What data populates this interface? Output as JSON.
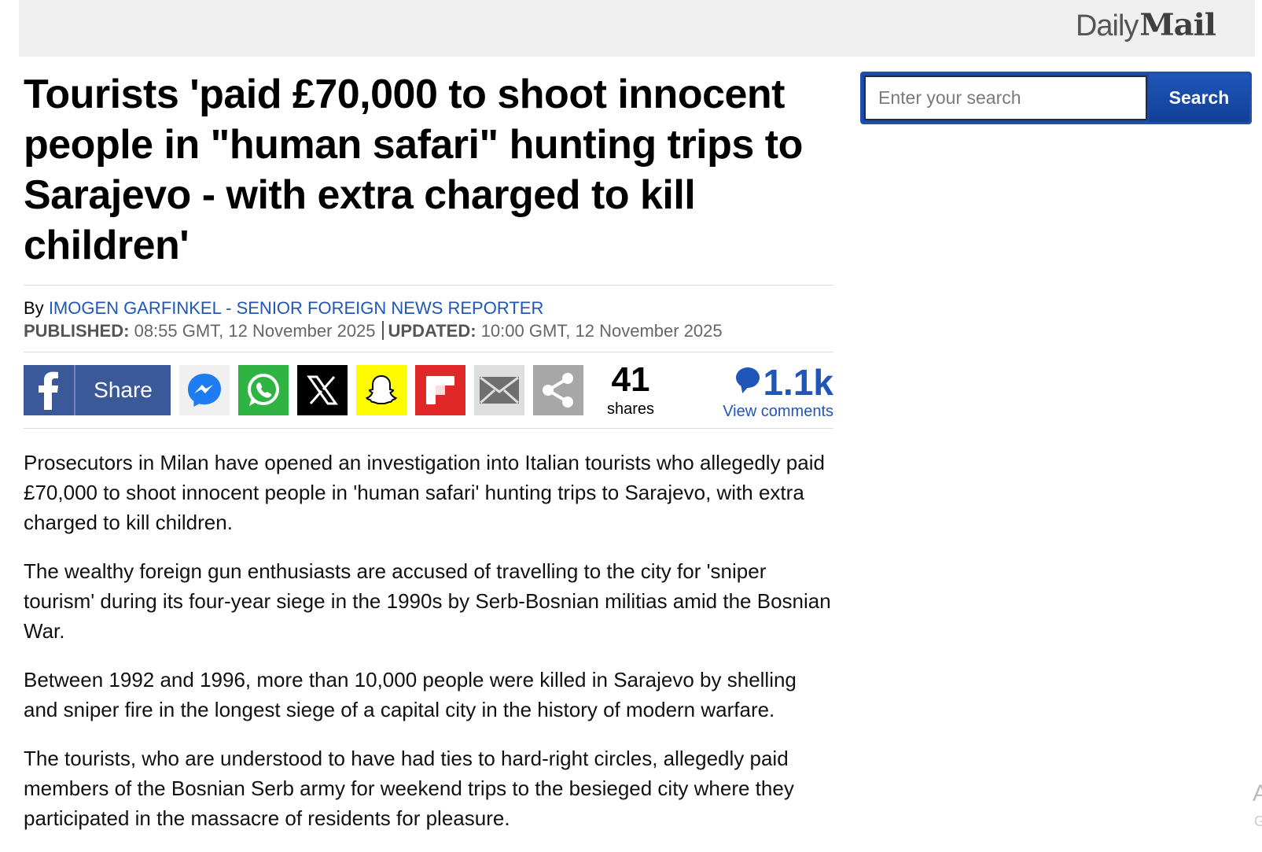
{
  "header": {
    "logo_daily": "Daily",
    "logo_mail": "Mail"
  },
  "search": {
    "placeholder": "Enter your search",
    "button_label": "Search"
  },
  "article": {
    "headline": "Tourists 'paid £70,000 to shoot innocent people in \"human safari\" hunting trips to Sarajevo - with extra charged to kill children'",
    "byline_prefix": "By",
    "author": "IMOGEN GARFINKEL - SENIOR FOREIGN NEWS REPORTER",
    "published_label": "PUBLISHED:",
    "published_value": "08:55 GMT, 12 November 2025",
    "updated_label": "UPDATED:",
    "updated_value": "10:00 GMT, 12 November 2025",
    "paragraphs": [
      "Prosecutors in Milan have opened an investigation into Italian tourists who allegedly paid £70,000 to shoot innocent people in 'human safari' hunting trips to Sarajevo, with extra charged to kill children.",
      "The wealthy foreign gun enthusiasts are accused of travelling to the city for 'sniper tourism' during its four-year siege in the 1990s by Serb-Bosnian militias amid the Bosnian War.",
      "Between 1992 and 1996, more than 10,000 people were killed in Sarajevo by shelling and sniper fire in the longest siege of a capital city in the history of modern warfare.",
      "The tourists, who are understood to have had ties to hard-right circles, allegedly paid members of the Bosnian Serb army for weekend trips to the besieged city where they participated in the massacre of residents for pleasure."
    ]
  },
  "share": {
    "facebook_label": "Share",
    "count": "41",
    "count_label": "shares",
    "buttons": [
      "facebook-icon",
      "messenger-icon",
      "whatsapp-icon",
      "x-icon",
      "snapchat-icon",
      "flipboard-icon",
      "email-icon",
      "share-icon"
    ],
    "colors": {
      "facebook": "#3b5998",
      "whatsapp": "#2fb443",
      "x": "#000000",
      "snapchat": "#fffc00",
      "flipboard": "#e12828"
    }
  },
  "comments": {
    "count": "1.1k",
    "label": "View comments"
  },
  "edge": {
    "clipped_a": "A",
    "clipped_g": "G"
  }
}
